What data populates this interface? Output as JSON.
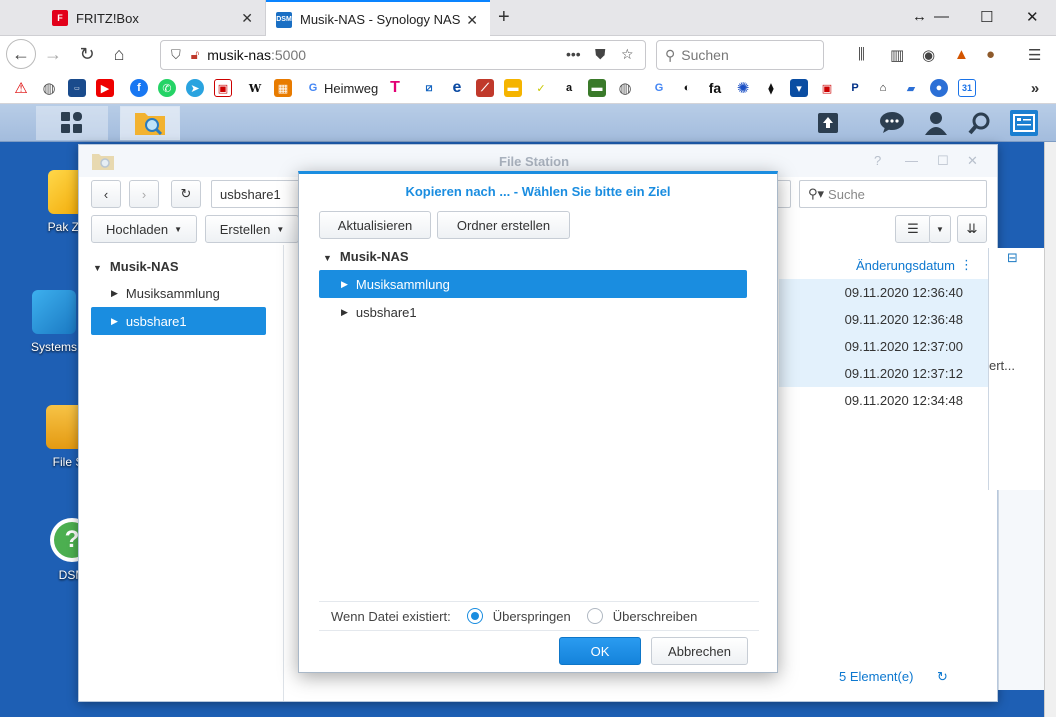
{
  "browser": {
    "tabs": [
      {
        "title": "FRITZ!Box",
        "active": false
      },
      {
        "title": "Musik-NAS - Synology NAS",
        "active": true
      }
    ],
    "url_host": "musik-nas",
    "url_port": ":5000",
    "search_placeholder": "Suchen",
    "bookmark_label": "Heimweg",
    "tab1_favicon": "F",
    "tab2_favicon": "DSM"
  },
  "desktop": {
    "icons": [
      "Pak Zen",
      "Systems",
      "File S",
      "DSM"
    ]
  },
  "file_station": {
    "title": "File Station",
    "path": "usbshare1",
    "search_placeholder": "Suche",
    "upload_label": "Hochladen",
    "create_label": "Erstellen",
    "tree_root": "Musik-NAS",
    "tree_items": [
      {
        "label": "Musiksammlung",
        "selected": false
      },
      {
        "label": "usbshare1",
        "selected": true
      }
    ],
    "column_header": "Änderungsdatum",
    "rows": [
      {
        "date": "09.11.2020 12:36:40",
        "selected": true
      },
      {
        "date": "09.11.2020 12:36:48",
        "selected": true
      },
      {
        "date": "09.11.2020 12:37:00",
        "selected": true
      },
      {
        "date": "09.11.2020 12:37:12",
        "selected": true
      },
      {
        "date": "09.11.2020 12:34:48",
        "selected": false
      }
    ],
    "side_text": "ert...",
    "status": "5 Element(e)"
  },
  "dialog": {
    "title": "Kopieren nach ... - Wählen Sie bitte ein Ziel",
    "refresh_label": "Aktualisieren",
    "new_folder_label": "Ordner erstellen",
    "tree_root": "Musik-NAS",
    "items": [
      {
        "label": "Musiksammlung",
        "selected": true
      },
      {
        "label": "usbshare1",
        "selected": false
      }
    ],
    "exists_label": "Wenn Datei existiert:",
    "options": [
      {
        "label": "Überspringen",
        "checked": true
      },
      {
        "label": "Überschreiben",
        "checked": false
      }
    ],
    "ok_label": "OK",
    "cancel_label": "Abbrechen"
  },
  "colors": {
    "accent": "#1a8de0",
    "desktop": "#1e5fb4"
  }
}
